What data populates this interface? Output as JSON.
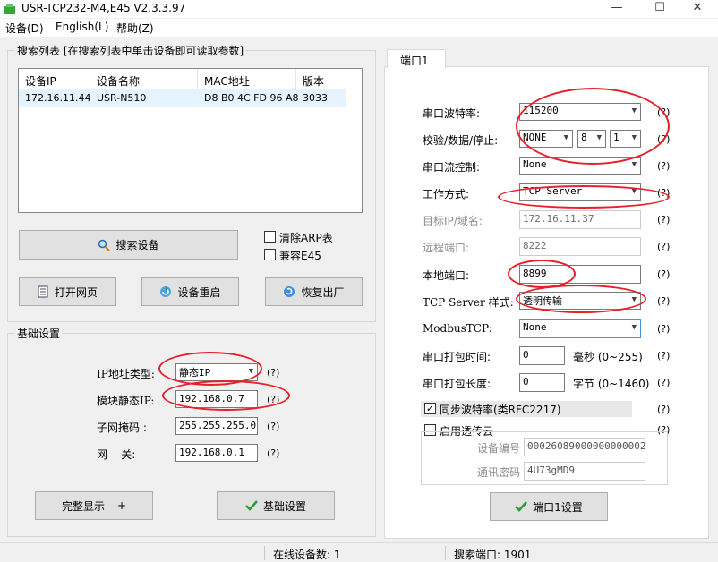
{
  "window": {
    "title": "USR-TCP232-M4,E45 V2.3.3.97",
    "minimize": "—",
    "maximize": "☐",
    "close": "✕"
  },
  "menu": [
    "设备(D)",
    "English(L)",
    "帮助(Z)"
  ],
  "search_group": {
    "title": "搜索列表 [在搜索列表中单击设备即可读取参数]",
    "columns": [
      "设备IP",
      "设备名称",
      "MAC地址",
      "版本"
    ],
    "rows": [
      {
        "ip": "172.16.11.44",
        "name": "USR-N510",
        "mac": "D8 B0 4C FD 96 A8",
        "version": "3033"
      }
    ],
    "search_button": "搜索设备",
    "clear_arp": "清除ARP表",
    "compat_e45": "兼容E45",
    "open_web": "打开网页",
    "restart": "设备重启",
    "factory_reset": "恢复出厂"
  },
  "basic": {
    "title": "基础设置",
    "ip_type_label": "IP地址类型:",
    "ip_type_value": "静态IP",
    "static_ip_label": "模块静态IP:",
    "static_ip_value": "192.168.0.7",
    "subnet_label": "子网掩码 :",
    "subnet_value": "255.255.255.0",
    "gateway_label": "网    关:",
    "gateway_value": "192.168.0.1",
    "help": "(?)",
    "full_display": "完整显示",
    "full_display_mark": "+",
    "basic_button": "基础设置"
  },
  "port": {
    "tab": "端口1",
    "baud_label": "串口波特率:",
    "baud_value": "115200",
    "parity_label": "校验/数据/停止:",
    "parity_value": "NONE",
    "data_value": "8",
    "stop_value": "1",
    "flow_label": "串口流控制:",
    "flow_value": "None",
    "mode_label": "工作方式:",
    "mode_value": "TCP Server",
    "target_label": "目标IP/域名:",
    "target_value": "172.16.11.37",
    "remote_label": "远程端口:",
    "remote_value": "8222",
    "local_label": "本地端口:",
    "local_value": "8899",
    "server_style_label": "TCP Server 样式:",
    "server_style_value": "透明传输",
    "modbus_label": "ModbusTCP:",
    "modbus_value": "None",
    "pack_time_label": "串口打包时间:",
    "pack_time_value": "0",
    "pack_time_unit": "毫秒 (0~255)",
    "pack_len_label": "串口打包长度:",
    "pack_len_value": "0",
    "pack_len_unit": "字节 (0~1460)",
    "sync_baud": "同步波特率(类RFC2217)",
    "cloud": "启用透传云",
    "device_id_label": "设备编号",
    "device_id_value": "00026089000000000002",
    "password_label": "通讯密码",
    "password_value": "4U73gMD9",
    "apply_button": "端口1设置",
    "help": "(?)"
  },
  "status": {
    "online": "在线设备数: 1",
    "search_port": "搜索端口: 1901"
  },
  "colors": {
    "annotation": "#e8202a",
    "selection": "#e5f3ff"
  }
}
